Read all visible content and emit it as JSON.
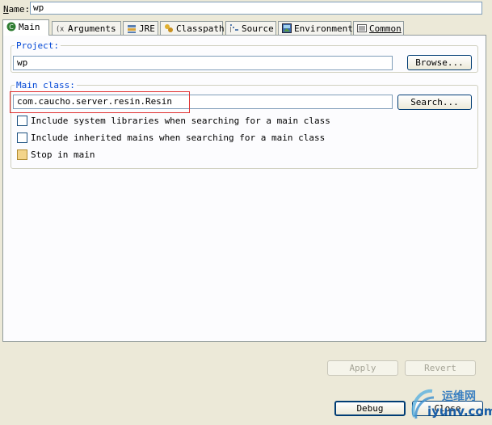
{
  "name_label": "Name:",
  "name_value": "wp",
  "tabs": [
    {
      "label": "Main",
      "icon": "main-icon"
    },
    {
      "label": "Arguments",
      "icon": "arguments-icon"
    },
    {
      "label": "JRE",
      "icon": "jre-icon"
    },
    {
      "label": "Classpath",
      "icon": "classpath-icon"
    },
    {
      "label": "Source",
      "icon": "source-icon"
    },
    {
      "label": "Environment",
      "icon": "environment-icon"
    },
    {
      "label": "Common",
      "icon": "common-icon"
    }
  ],
  "project": {
    "legend": "Project:",
    "value": "wp",
    "browse_label": "Browse..."
  },
  "main_class": {
    "legend": "Main class:",
    "value": "com.caucho.server.resin.Resin",
    "search_label": "Search...",
    "options": [
      {
        "label": "Include system libraries when searching for a main class"
      },
      {
        "label": "Include inherited mains when searching for a main class"
      },
      {
        "label": "Stop in main"
      }
    ]
  },
  "buttons": {
    "apply": "Apply",
    "revert": "Revert",
    "debug": "Debug",
    "close": "Close"
  },
  "watermark": {
    "text": "运维网",
    "domain": "iyunv.com"
  }
}
